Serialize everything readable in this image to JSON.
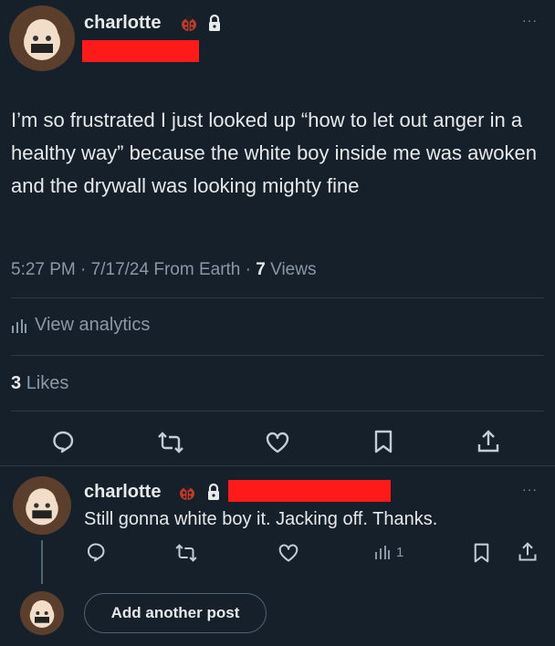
{
  "post": {
    "author": "charlotte",
    "text": "I’m so frustrated I just looked up “how to let out anger in a healthy way” because the white boy inside me was awoken and the drywall was looking mighty fine",
    "time": "5:27 PM",
    "sep1": "·",
    "date": "7/17/24",
    "location": "From Earth",
    "sep2": "·",
    "views_count": "7",
    "views_label": "Views",
    "analytics": "View analytics",
    "likes_count": "3",
    "likes_label": "Likes",
    "more": "···"
  },
  "reply": {
    "author": "charlotte",
    "text": "Still gonna white boy it. Jacking off. Thanks.",
    "views": "1",
    "more": "···"
  },
  "composer": {
    "button": "Add another post"
  },
  "colors": {
    "background": "#15202b",
    "text": "#e7e9ea",
    "muted": "#8b98a5",
    "redaction": "#ff1a1a"
  },
  "icons": [
    "ladybug-icon",
    "lock-icon",
    "more-icon",
    "analytics-icon",
    "reply-icon",
    "repost-icon",
    "like-icon",
    "bookmark-icon",
    "share-icon"
  ]
}
